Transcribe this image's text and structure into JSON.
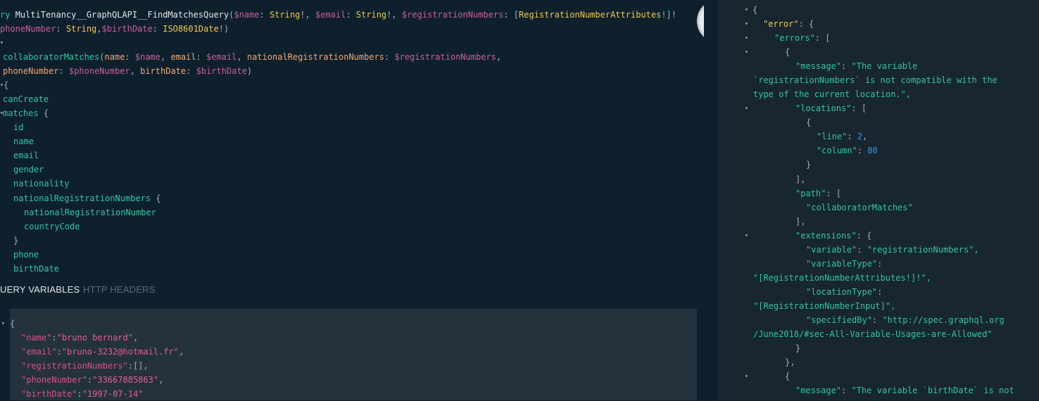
{
  "query_editor": {
    "line1": {
      "prefix": "ry ",
      "name": "MultiTenancy__GraphQLAPI__FindMatchesQuery",
      "open": "(",
      "v_name": "$name",
      "t_string1": "String",
      "v_email": "$email",
      "t_string2": "String",
      "v_reg": "$registrationNumbers",
      "t_reg": "RegistrationNumberAttributes"
    },
    "line2": {
      "v_phone": "phoneNumber",
      "t_string3": "String",
      "v_birth": "$birthDate",
      "t_iso": "ISO8601Date"
    },
    "line4": {
      "field": "collaboratorMatches",
      "a_name": "name",
      "v_name": "$name",
      "a_email": "email",
      "v_email": "$email",
      "a_nrn": "nationalRegistrationNumbers",
      "v_reg": "$registrationNumbers"
    },
    "line5": {
      "a_phone": "phoneNumber",
      "v_phone": "$phoneNumber",
      "a_birth": "birthDate",
      "v_birth": "$birthDate"
    },
    "fields": {
      "canCreate": "canCreate",
      "matches": "matches",
      "id": "id",
      "name": "name",
      "email": "email",
      "gender": "gender",
      "nationality": "nationality",
      "nrn": "nationalRegistrationNumbers",
      "nrn_single": "nationalRegistrationNumber",
      "countryCode": "countryCode",
      "phone": "phone",
      "birthDate": "birthDate"
    }
  },
  "tabs": {
    "query_variables": "UERY VARIABLES",
    "http_headers": "HTTP HEADERS"
  },
  "variables": {
    "name_key": "\"name\"",
    "name_val": "\"bruno bernard\"",
    "email_key": "\"email\"",
    "email_val": "\"bruno-3232@hotmail.fr\"",
    "reg_key": "\"registrationNumbers\"",
    "reg_val": "[]",
    "phone_key": "\"phoneNumber\"",
    "phone_val": "\"33667885863\"",
    "birth_key": "\"birthDate\"",
    "birth_val": "\"1997-07-14\""
  },
  "result": {
    "error_key": "\"error\"",
    "errors_key": "\"errors\"",
    "message_key": "\"message\"",
    "message_val_1": "\"The variable",
    "message_val_2": "`registrationNumbers` is not compatible with the",
    "message_val_3": "type of the current location.\",",
    "locations_key": "\"locations\"",
    "line_key": "\"line\"",
    "line_val": "2",
    "column_key": "\"column\"",
    "column_val": "80",
    "path_key": "\"path\"",
    "path_val": "\"collaboratorMatches\"",
    "extensions_key": "\"extensions\"",
    "variable_key": "\"variable\"",
    "variable_val": "\"registrationNumbers\",",
    "variableType_key": "\"variableType\"",
    "variableType_val": "\"[RegistrationNumberAttributes!]!\",",
    "locationType_key": "\"locationType\"",
    "locationType_val": "\"[RegistrationNumberInput]\",",
    "specifiedBy_key": "\"specifiedBy\"",
    "specifiedBy_val_1": "\"http://spec.graphql.org",
    "specifiedBy_val_2": "/June2018/#sec-All-Variable-Usages-are-Allowed\"",
    "message2_key": "\"message\"",
    "message2_val": "\"The variable `birthDate` is not"
  }
}
